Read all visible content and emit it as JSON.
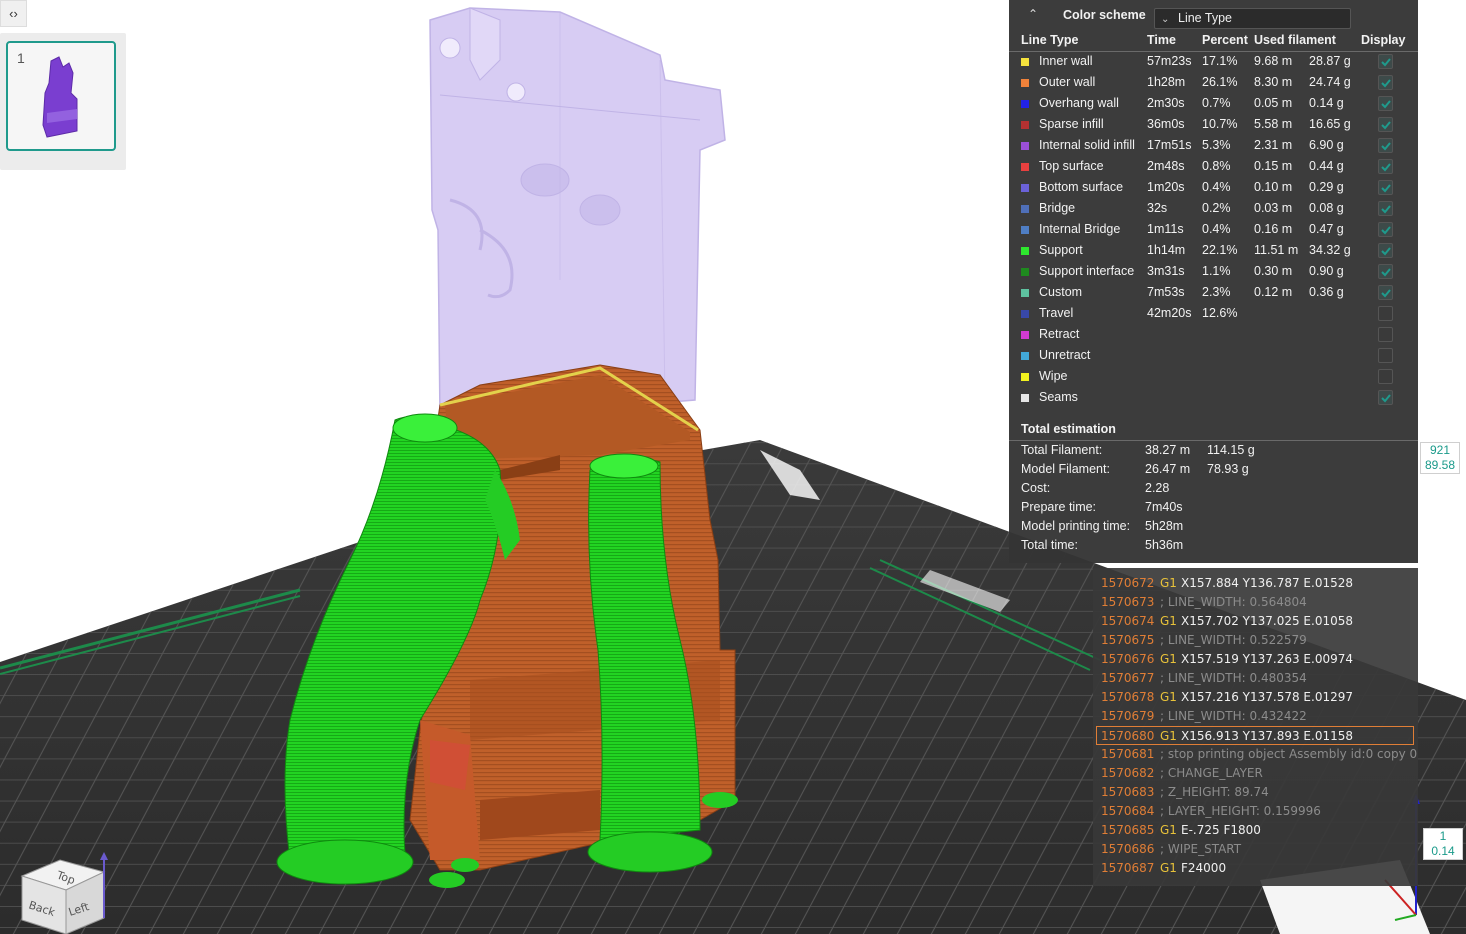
{
  "plate": {
    "number": "1"
  },
  "legend": {
    "header_label": "Color scheme",
    "scheme_value": "Line Type",
    "columns": {
      "type": "Line Type",
      "time": "Time",
      "percent": "Percent",
      "used": "Used filament",
      "display": "Display"
    },
    "rows": [
      {
        "name": "Inner wall",
        "color": "#f5e23d",
        "time": "57m23s",
        "percent": "17.1%",
        "length": "9.68 m",
        "weight": "28.87 g",
        "shown": true
      },
      {
        "name": "Outer wall",
        "color": "#f0823a",
        "time": "1h28m",
        "percent": "26.1%",
        "length": "8.30 m",
        "weight": "24.74 g",
        "shown": true
      },
      {
        "name": "Overhang wall",
        "color": "#2222e8",
        "time": "2m30s",
        "percent": "0.7%",
        "length": "0.05 m",
        "weight": "0.14 g",
        "shown": true
      },
      {
        "name": "Sparse infill",
        "color": "#b33131",
        "time": "36m0s",
        "percent": "10.7%",
        "length": "5.58 m",
        "weight": "16.65 g",
        "shown": true
      },
      {
        "name": "Internal solid infill",
        "color": "#9b4fd6",
        "time": "17m51s",
        "percent": "5.3%",
        "length": "2.31 m",
        "weight": "6.90 g",
        "shown": true
      },
      {
        "name": "Top surface",
        "color": "#e8403f",
        "time": "2m48s",
        "percent": "0.8%",
        "length": "0.15 m",
        "weight": "0.44 g",
        "shown": true
      },
      {
        "name": "Bottom surface",
        "color": "#6b62d8",
        "time": "1m20s",
        "percent": "0.4%",
        "length": "0.10 m",
        "weight": "0.29 g",
        "shown": true
      },
      {
        "name": "Bridge",
        "color": "#4f6fb8",
        "time": "32s",
        "percent": "0.2%",
        "length": "0.03 m",
        "weight": "0.08 g",
        "shown": true
      },
      {
        "name": "Internal Bridge",
        "color": "#4f7ec4",
        "time": "1m11s",
        "percent": "0.4%",
        "length": "0.16 m",
        "weight": "0.47 g",
        "shown": true
      },
      {
        "name": "Support",
        "color": "#2ee82e",
        "time": "1h14m",
        "percent": "22.1%",
        "length": "11.51 m",
        "weight": "34.32 g",
        "shown": true
      },
      {
        "name": "Support interface",
        "color": "#1f8a1f",
        "time": "3m31s",
        "percent": "1.1%",
        "length": "0.30 m",
        "weight": "0.90 g",
        "shown": true
      },
      {
        "name": "Custom",
        "color": "#5ec2a0",
        "time": "7m53s",
        "percent": "2.3%",
        "length": "0.12 m",
        "weight": "0.36 g",
        "shown": true
      },
      {
        "name": "Travel",
        "color": "#3848a8",
        "time": "42m20s",
        "percent": "12.6%",
        "length": "",
        "weight": "",
        "shown": false
      },
      {
        "name": "Retract",
        "color": "#d23bd2",
        "time": "",
        "percent": "",
        "length": "",
        "weight": "",
        "shown": false
      },
      {
        "name": "Unretract",
        "color": "#42a8d8",
        "time": "",
        "percent": "",
        "length": "",
        "weight": "",
        "shown": false
      },
      {
        "name": "Wipe",
        "color": "#f2f21f",
        "time": "",
        "percent": "",
        "length": "",
        "weight": "",
        "shown": false
      },
      {
        "name": "Seams",
        "color": "#e6e6e6",
        "time": "",
        "percent": "",
        "length": "",
        "weight": "",
        "shown": true
      }
    ],
    "totals_title": "Total estimation",
    "totals": [
      {
        "label": "Total Filament:",
        "v1": "38.27 m",
        "v2": "114.15 g"
      },
      {
        "label": "Model Filament:",
        "v1": "26.47 m",
        "v2": "78.93 g"
      },
      {
        "label": "Cost:",
        "v1": "2.28",
        "v2": ""
      },
      {
        "label": "Prepare time:",
        "v1": "7m40s",
        "v2": ""
      },
      {
        "label": "Model printing time:",
        "v1": "5h28m",
        "v2": ""
      },
      {
        "label": "Total time:",
        "v1": "5h36m",
        "v2": ""
      }
    ]
  },
  "gcode": {
    "lines": [
      {
        "num": "1570672",
        "cmd": "G1",
        "args": "X157.884 Y136.787 E.01528",
        "comment": "",
        "active": false
      },
      {
        "num": "1570673",
        "cmd": "",
        "args": "",
        "comment": "; LINE_WIDTH: 0.564804",
        "active": false
      },
      {
        "num": "1570674",
        "cmd": "G1",
        "args": "X157.702 Y137.025 E.01058",
        "comment": "",
        "active": false
      },
      {
        "num": "1570675",
        "cmd": "",
        "args": "",
        "comment": "; LINE_WIDTH: 0.522579",
        "active": false
      },
      {
        "num": "1570676",
        "cmd": "G1",
        "args": "X157.519 Y137.263 E.00974",
        "comment": "",
        "active": false
      },
      {
        "num": "1570677",
        "cmd": "",
        "args": "",
        "comment": "; LINE_WIDTH: 0.480354",
        "active": false
      },
      {
        "num": "1570678",
        "cmd": "G1",
        "args": "X157.216 Y137.578 E.01297",
        "comment": "",
        "active": false
      },
      {
        "num": "1570679",
        "cmd": "",
        "args": "",
        "comment": "; LINE_WIDTH: 0.432422",
        "active": false
      },
      {
        "num": "1570680",
        "cmd": "G1",
        "args": "X156.913 Y137.893 E.01158",
        "comment": "",
        "active": true
      },
      {
        "num": "1570681",
        "cmd": "",
        "args": "",
        "comment": "; stop printing object Assembly id:0 copy 0",
        "active": false
      },
      {
        "num": "1570682",
        "cmd": "",
        "args": "",
        "comment": "; CHANGE_LAYER",
        "active": false
      },
      {
        "num": "1570683",
        "cmd": "",
        "args": "",
        "comment": "; Z_HEIGHT: 89.74",
        "active": false
      },
      {
        "num": "1570684",
        "cmd": "",
        "args": "",
        "comment": "; LAYER_HEIGHT: 0.159996",
        "active": false
      },
      {
        "num": "1570685",
        "cmd": "G1",
        "args": "E-.725 F1800",
        "comment": "",
        "active": false
      },
      {
        "num": "1570686",
        "cmd": "",
        "args": "",
        "comment": "; WIPE_START",
        "active": false
      },
      {
        "num": "1570687",
        "cmd": "G1",
        "args": "F24000",
        "comment": "",
        "active": false
      }
    ]
  },
  "layer_slider": {
    "top_layer": "921",
    "top_height": "89.58",
    "bottom_layer": "1",
    "bottom_height": "0.14"
  },
  "view_cube": {
    "top": "Top",
    "left": "Left",
    "back": "Back"
  },
  "colors": {
    "accent": "#1f9a8c",
    "support": "#2ee82e",
    "outer_wall": "#c8652e",
    "model_ghost": "#a78be0"
  }
}
